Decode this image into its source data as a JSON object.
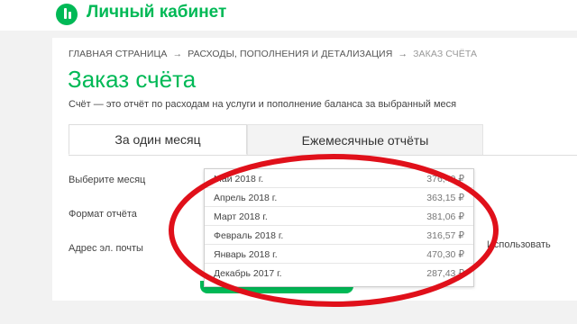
{
  "header": {
    "brand": "Личный кабинет",
    "logo_icon": "megafon-logo-icon"
  },
  "breadcrumb": {
    "items": [
      "ГЛАВНАЯ СТРАНИЦА",
      "РАСХОДЫ, ПОПОЛНЕНИЯ И ДЕТАЛИЗАЦИЯ",
      "ЗАКАЗ СЧЁТА"
    ],
    "separator": "→"
  },
  "page": {
    "title": "Заказ счёта",
    "description": "Счёт — это отчёт по расходам на услуги и пополнение баланса за выбранный меся"
  },
  "tabs": [
    {
      "label": "За один месяц",
      "active": true
    },
    {
      "label": "Ежемесячные отчёты",
      "active": false
    }
  ],
  "form": {
    "month_label": "Выберите месяц",
    "format_label": "Формат отчёта",
    "email_label": "Адрес эл. почты",
    "use_label": "Использовать"
  },
  "month_options": [
    {
      "month": "Май 2018 г.",
      "amount": "376,40 ₽"
    },
    {
      "month": "Апрель 2018 г.",
      "amount": "363,15 ₽"
    },
    {
      "month": "Март 2018 г.",
      "amount": "381,06 ₽"
    },
    {
      "month": "Февраль 2018 г.",
      "amount": "316,57 ₽"
    },
    {
      "month": "Январь 2018 г.",
      "amount": "470,30 ₽"
    },
    {
      "month": "Декабрь 2017 г.",
      "amount": "287,43 ₽"
    }
  ],
  "colors": {
    "brand_green": "#00b956",
    "annotation_red": "#e0101a"
  }
}
